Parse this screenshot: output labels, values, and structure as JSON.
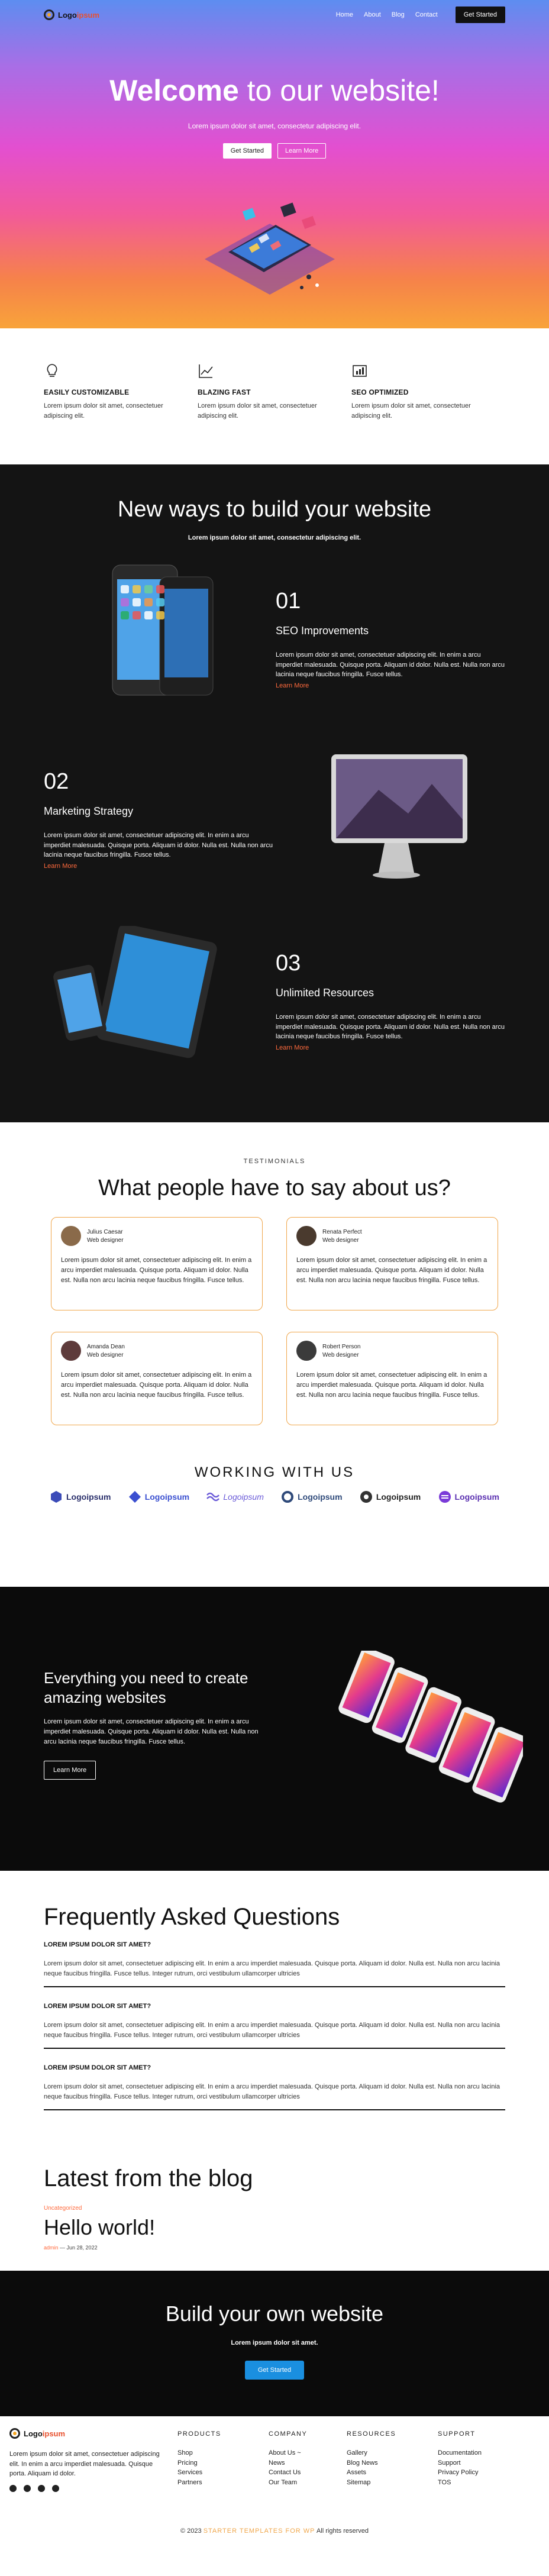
{
  "brand": {
    "logo_primary": "Logo",
    "logo_secondary": "ipsum",
    "accent": "#e8512e"
  },
  "nav": {
    "links": [
      "Home",
      "About",
      "Blog",
      "Contact"
    ],
    "cta": "Get Started"
  },
  "hero": {
    "title_bold": "Welcome",
    "title_rest": " to our website!",
    "subtitle": "Lorem ipsum dolor sit amet, consectetur adipiscing elit.",
    "btn_primary": "Get Started",
    "btn_secondary": "Learn More"
  },
  "features": [
    {
      "icon": "lightbulb-icon",
      "title": "EASILY CUSTOMIZABLE",
      "text": "Lorem ipsum dolor sit amet, consectetuer adipiscing elit."
    },
    {
      "icon": "chart-line-icon",
      "title": "BLAZING FAST",
      "text": "Lorem ipsum dolor sit amet, consectetuer adipiscing elit."
    },
    {
      "icon": "seo-chart-icon",
      "title": "SEO OPTIMIZED",
      "text": "Lorem ipsum dolor sit amet, consectetuer adipiscing elit."
    }
  ],
  "services": {
    "title": "New ways to build your website",
    "subtitle": "Lorem ipsum dolor sit amet, consectetur adipiscing elit.",
    "items": [
      {
        "num": "01",
        "title": "SEO Improvements",
        "text": "Lorem ipsum dolor sit amet, consectetuer adipiscing elit. In enim a arcu imperdiet malesuada. Quisque porta. Aliquam id dolor. Nulla est. Nulla non arcu lacinia neque faucibus fringilla. Fusce tellus.",
        "link": "Learn More"
      },
      {
        "num": "02",
        "title": "Marketing Strategy",
        "text": "Lorem ipsum dolor sit amet, consectetuer adipiscing elit. In enim a arcu imperdiet malesuada. Quisque porta. Aliquam id dolor. Nulla est. Nulla non arcu lacinia neque faucibus fringilla. Fusce tellus.",
        "link": "Learn More"
      },
      {
        "num": "03",
        "title": "Unlimited Resources",
        "text": "Lorem ipsum dolor sit amet, consectetuer adipiscing elit. In enim a arcu imperdiet malesuada. Quisque porta. Aliquam id dolor. Nulla est. Nulla non arcu lacinia neque faucibus fringilla. Fusce tellus.",
        "link": "Learn More"
      }
    ]
  },
  "testimonials": {
    "eyebrow": "TESTIMONIALS",
    "title": "What people have to say about us?",
    "items": [
      {
        "name": "Julius Caesar",
        "role": "Web designer",
        "text": "Lorem ipsum dolor sit amet, consectetuer adipiscing elit. In enim a arcu imperdiet malesuada. Quisque porta. Aliquam id dolor. Nulla est. Nulla non arcu lacinia neque faucibus fringilla. Fusce tellus."
      },
      {
        "name": "Renata Perfect",
        "role": "Web designer",
        "text": "Lorem ipsum dolor sit amet, consectetuer adipiscing elit. In enim a arcu imperdiet malesuada. Quisque porta. Aliquam id dolor. Nulla est. Nulla non arcu lacinia neque faucibus fringilla. Fusce tellus."
      },
      {
        "name": "Amanda Dean",
        "role": "Web designer",
        "text": "Lorem ipsum dolor sit amet, consectetuer adipiscing elit. In enim a arcu imperdiet malesuada. Quisque porta. Aliquam id dolor. Nulla est. Nulla non arcu lacinia neque faucibus fringilla. Fusce tellus."
      },
      {
        "name": "Robert Person",
        "role": "Web designer",
        "text": "Lorem ipsum dolor sit amet, consectetuer adipiscing elit. In enim a arcu imperdiet malesuada. Quisque porta. Aliquam id dolor. Nulla est. Nulla non arcu lacinia neque faucibus fringilla. Fusce tellus."
      }
    ]
  },
  "partners": {
    "title": "WORKING WITH US",
    "items": [
      "Logoipsum",
      "Logoipsum",
      "Logoipsum",
      "Logoipsum",
      "Logoipsum",
      "Logoipsum"
    ]
  },
  "promo": {
    "title": "Everything you need to create amazing websites",
    "text": "Lorem ipsum dolor sit amet, consectetuer adipiscing elit. In enim a arcu imperdiet malesuada. Quisque porta. Aliquam id dolor. Nulla est. Nulla non arcu lacinia neque faucibus fringilla. Fusce tellus.",
    "button": "Learn More"
  },
  "faq": {
    "title": "Frequently Asked Questions",
    "items": [
      {
        "q": "LOREM IPSUM DOLOR SIT AMET?",
        "a": "Lorem ipsum dolor sit amet, consectetuer adipiscing elit. In enim a arcu imperdiet malesuada. Quisque porta. Aliquam id dolor. Nulla est. Nulla non arcu lacinia neque faucibus fringilla. Fusce tellus. Integer rutrum, orci vestibulum ullamcorper ultricies"
      },
      {
        "q": "LOREM IPSUM DOLOR SIT AMET?",
        "a": "Lorem ipsum dolor sit amet, consectetuer adipiscing elit. In enim a arcu imperdiet malesuada. Quisque porta. Aliquam id dolor. Nulla est. Nulla non arcu lacinia neque faucibus fringilla. Fusce tellus. Integer rutrum, orci vestibulum ullamcorper ultricies"
      },
      {
        "q": "LOREM IPSUM DOLOR SIT AMET?",
        "a": "Lorem ipsum dolor sit amet, consectetuer adipiscing elit. In enim a arcu imperdiet malesuada. Quisque porta. Aliquam id dolor. Nulla est. Nulla non arcu lacinia neque faucibus fringilla. Fusce tellus. Integer rutrum, orci vestibulum ullamcorper ultricies"
      }
    ]
  },
  "blog": {
    "title": "Latest from the blog",
    "post": {
      "category": "Uncategorized",
      "title": "Hello world!",
      "author": "admin",
      "date": "Jun 28, 2022"
    }
  },
  "cta": {
    "title": "Build your own website",
    "text": "Lorem ipsum dolor sit amet.",
    "button": "Get Started"
  },
  "footer": {
    "about": "Lorem ipsum dolor sit amet, consectetuer adipiscing elit. In enim a arcu imperdiet malesuada. Quisque porta. Aliquam id dolor.",
    "columns": [
      {
        "title": "PRODUCTS",
        "items": [
          "Shop",
          "Pricing",
          "Services",
          "Partners"
        ]
      },
      {
        "title": "COMPANY",
        "items": [
          "About Us ~",
          "News",
          "Contact Us",
          "Our Team"
        ]
      },
      {
        "title": "RESOURCES",
        "items": [
          "Gallery",
          "Blog News",
          "Assets",
          "Sitemap"
        ]
      },
      {
        "title": "SUPPORT",
        "items": [
          "Documentation",
          "Support",
          "Privacy Policy",
          "TOS"
        ]
      }
    ],
    "copy_prefix": "© 2023",
    "copy_brand": "STARTER TEMPLATES FOR WP",
    "copy_suffix": "All rights reserved",
    "social": [
      "facebook-icon",
      "twitter-icon",
      "youtube-icon",
      "linkedin-icon"
    ]
  }
}
